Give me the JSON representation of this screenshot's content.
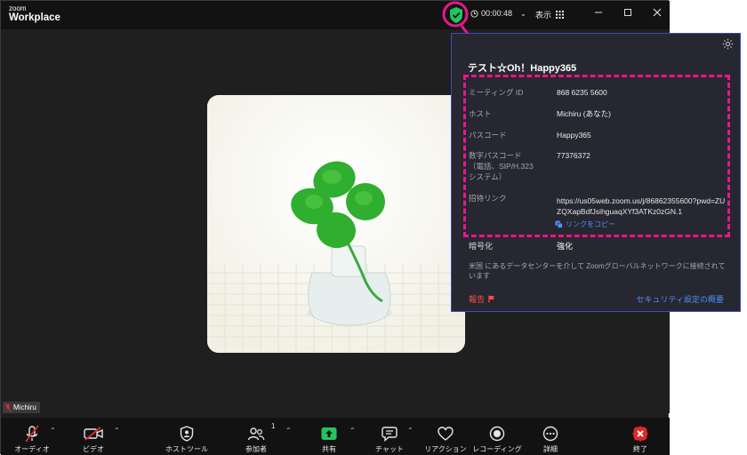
{
  "app": {
    "brand_small": "zoom",
    "brand": "Workplace"
  },
  "titlebar": {
    "timer": "00:00:48",
    "view_label": "表示"
  },
  "participant": {
    "name": "Michiru"
  },
  "panel": {
    "title": "テスト☆Oh！Happy365",
    "rows": [
      {
        "label": "ミーティング ID",
        "value": "868 6235 5600"
      },
      {
        "label": "ホスト",
        "value": "Michiru (あなた)"
      },
      {
        "label": "パスコード",
        "value": "Happy365"
      },
      {
        "label_1": "数字パスコード",
        "label_2": "（電話、SIP/H.323",
        "label_3": "システム）",
        "value": "77376372"
      }
    ],
    "invite_label": "招待リンク",
    "invite_link": "https://us05web.zoom.us/j/86862355600?pwd=ZUZQXapBdfJsihguaqXYf3ATKz0zGN.1",
    "copy_link": "リンクをコピー",
    "encryption_label": "暗号化",
    "encryption_value": "強化",
    "datacenter_info": "米国 にあるデータセンターを介して Zoomグローバルネットワークに接続されています",
    "report": "報告",
    "security_overview": "セキュリティ設定の概要"
  },
  "toolbar": {
    "audio": "オーディオ",
    "video": "ビデオ",
    "host_tools": "ホストツール",
    "participants": "参加者",
    "participants_count": "1",
    "share": "共有",
    "chat": "チャット",
    "reactions": "リアクション",
    "recording": "レコーディング",
    "details": "詳細",
    "end": "終了"
  },
  "colors": {
    "accent_pink": "#e8178a",
    "shield_green": "#22c55e",
    "share_green": "#22c55e",
    "link_blue": "#4f8ff7",
    "end_red": "#e02828"
  }
}
